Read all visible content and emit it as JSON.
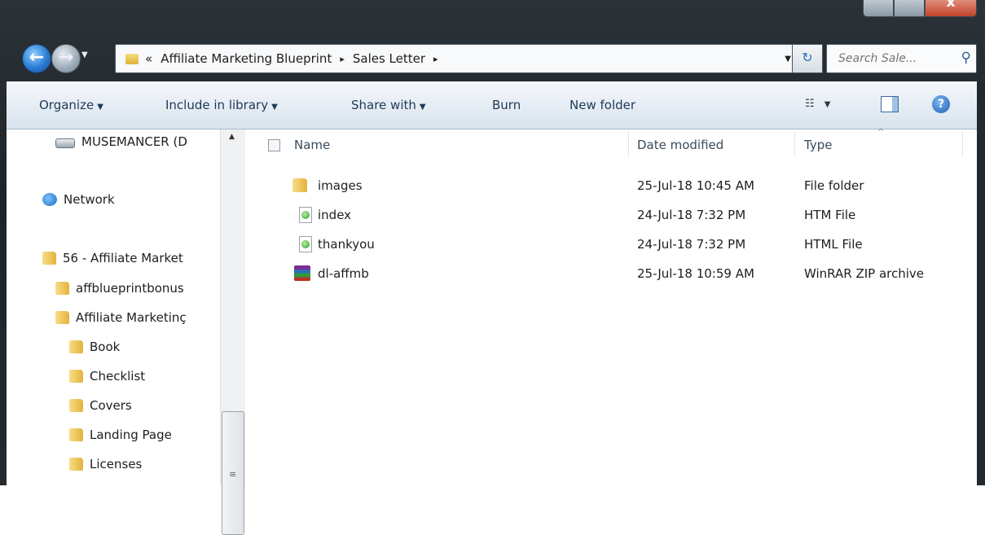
{
  "window": {
    "caption_close_label": "x"
  },
  "addressbar": {
    "back_glyph": "←",
    "forward_glyph": "→",
    "overflow": "«",
    "crumbs": [
      "Affiliate Marketing Blueprint",
      "Sales Letter"
    ],
    "separator": "▸",
    "refresh_glyph": "↻",
    "search_placeholder": "Search Sale..."
  },
  "toolbar": {
    "organize": "Organize",
    "include_in_library": "Include in library",
    "share_with": "Share with",
    "burn": "Burn",
    "new_folder": "New folder",
    "help": "?"
  },
  "navpane": {
    "items": [
      {
        "label": "MUSEMANCER (D",
        "icon": "drive-icon"
      },
      {
        "label": "Network",
        "icon": "network-icon"
      },
      {
        "label": "56 - Affiliate Market",
        "icon": "folder-icon"
      },
      {
        "label": "affblueprintbonus",
        "icon": "folder-icon"
      },
      {
        "label": "Affiliate Marketinç",
        "icon": "folder-icon"
      },
      {
        "label": "Book",
        "icon": "folder-icon"
      },
      {
        "label": "Checklist",
        "icon": "folder-icon"
      },
      {
        "label": "Covers",
        "icon": "folder-icon"
      },
      {
        "label": "Landing Page",
        "icon": "folder-icon"
      },
      {
        "label": "Licenses",
        "icon": "folder-icon"
      }
    ]
  },
  "columns": {
    "name": "Name",
    "date_modified": "Date modified",
    "type": "Type"
  },
  "files": [
    {
      "name": "images",
      "date": "25-Jul-18 10:45 AM",
      "type": "File folder",
      "icon": "folder-icon"
    },
    {
      "name": "index",
      "date": "24-Jul-18 7:32 PM",
      "type": "HTM File",
      "icon": "htm-file-icon"
    },
    {
      "name": "thankyou",
      "date": "24-Jul-18 7:32 PM",
      "type": "HTML File",
      "icon": "html-file-icon"
    },
    {
      "name": "dl-affmb",
      "date": "25-Jul-18 10:59 AM",
      "type": "WinRAR ZIP archive",
      "icon": "winrar-archive-icon"
    }
  ],
  "colors": {
    "frame": "#1f2428",
    "toolbar_text": "#1e3a57"
  }
}
